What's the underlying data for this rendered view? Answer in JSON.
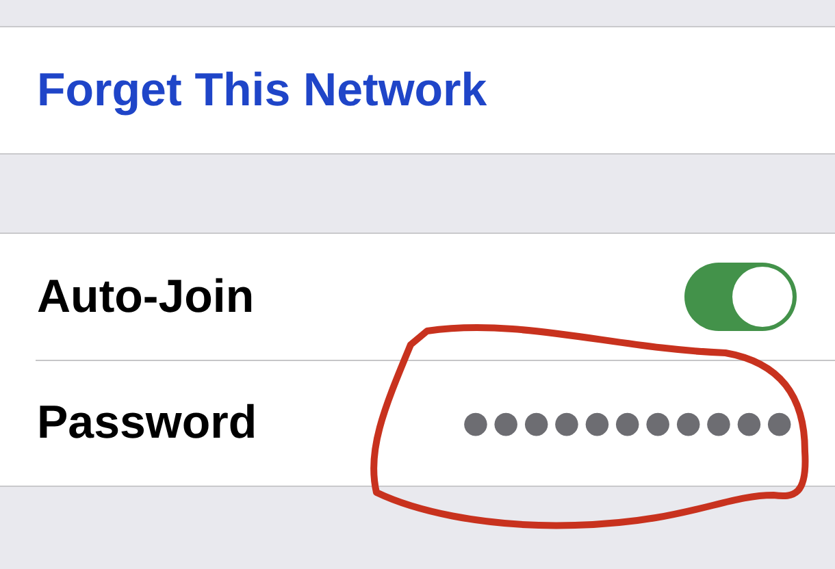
{
  "forget_network": {
    "label": "Forget This Network"
  },
  "settings": [
    {
      "kind": "toggle",
      "label": "Auto-Join",
      "on": true
    },
    {
      "kind": "password",
      "label": "Password",
      "value": "●●●●●●●●●●●"
    }
  ]
}
